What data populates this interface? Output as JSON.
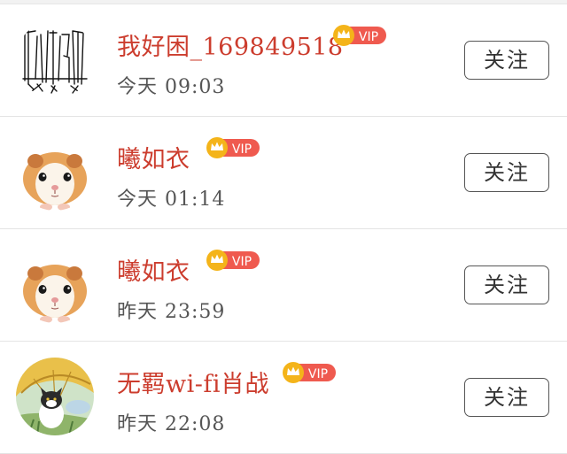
{
  "follow_list": {
    "items": [
      {
        "username": "我好困_169849518",
        "badge_label": "VIP",
        "timestamp": "今天 09:03",
        "follow_label": "关注",
        "avatar": "sketch-drawing-avatar"
      },
      {
        "username": "曦如衣",
        "badge_label": "VIP",
        "timestamp": "今天 01:14",
        "follow_label": "关注",
        "avatar": "guinea-pig-avatar"
      },
      {
        "username": "曦如衣",
        "badge_label": "VIP",
        "timestamp": "昨天 23:59",
        "follow_label": "关注",
        "avatar": "guinea-pig-avatar"
      },
      {
        "username": "无羁wi-fi肖战",
        "badge_label": "VIP",
        "timestamp": "昨天 22:08",
        "follow_label": "关注",
        "avatar": "cat-umbrella-avatar"
      }
    ]
  },
  "colors": {
    "username": "#cc3d2e",
    "vip_badge": "#ef5a4f",
    "crown": "#f4b41a",
    "timestamp": "#555555",
    "button_border": "#555555"
  }
}
